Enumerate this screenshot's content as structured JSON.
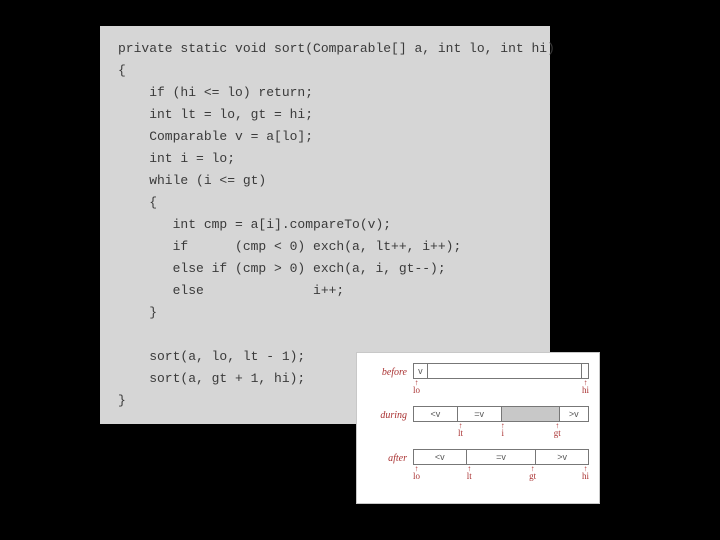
{
  "code": {
    "lines": [
      "private static void sort(Comparable[] a, int lo, int hi)",
      "{",
      "    if (hi <= lo) return;",
      "    int lt = lo, gt = hi;",
      "    Comparable v = a[lo];",
      "    int i = lo;",
      "    while (i <= gt)",
      "    {",
      "       int cmp = a[i].compareTo(v);",
      "       if      (cmp < 0) exch(a, lt++, i++);",
      "       else if (cmp > 0) exch(a, i, gt--);",
      "       else              i++;",
      "    }",
      "",
      "    sort(a, lo, lt - 1);",
      "    sort(a, gt + 1, hi);",
      "}"
    ]
  },
  "diagram": {
    "rows": {
      "before": {
        "label": "before",
        "segments": [
          {
            "text": "v",
            "flex": 1,
            "shade": false
          },
          {
            "text": "",
            "flex": 12,
            "shade": false
          },
          {
            "text": "",
            "flex": 0.5,
            "shade": false
          }
        ],
        "ticks": [
          {
            "label": "lo",
            "pos": 2
          },
          {
            "label": "hi",
            "pos": 98
          }
        ]
      },
      "during": {
        "label": "during",
        "segments": [
          {
            "text": "<v",
            "flex": 3,
            "shade": false
          },
          {
            "text": "=v",
            "flex": 3,
            "shade": false
          },
          {
            "text": "",
            "flex": 4,
            "shade": true
          },
          {
            "text": ">v",
            "flex": 2,
            "shade": false
          }
        ],
        "ticks": [
          {
            "label": "lt",
            "pos": 27
          },
          {
            "label": "i",
            "pos": 51
          },
          {
            "label": "gt",
            "pos": 82
          }
        ]
      },
      "after": {
        "label": "after",
        "segments": [
          {
            "text": "<v",
            "flex": 3,
            "shade": false
          },
          {
            "text": "=v",
            "flex": 4,
            "shade": false
          },
          {
            "text": ">v",
            "flex": 3,
            "shade": false
          }
        ],
        "ticks": [
          {
            "label": "lo",
            "pos": 2
          },
          {
            "label": "lt",
            "pos": 32
          },
          {
            "label": "gt",
            "pos": 68
          },
          {
            "label": "hi",
            "pos": 98
          }
        ]
      }
    }
  }
}
